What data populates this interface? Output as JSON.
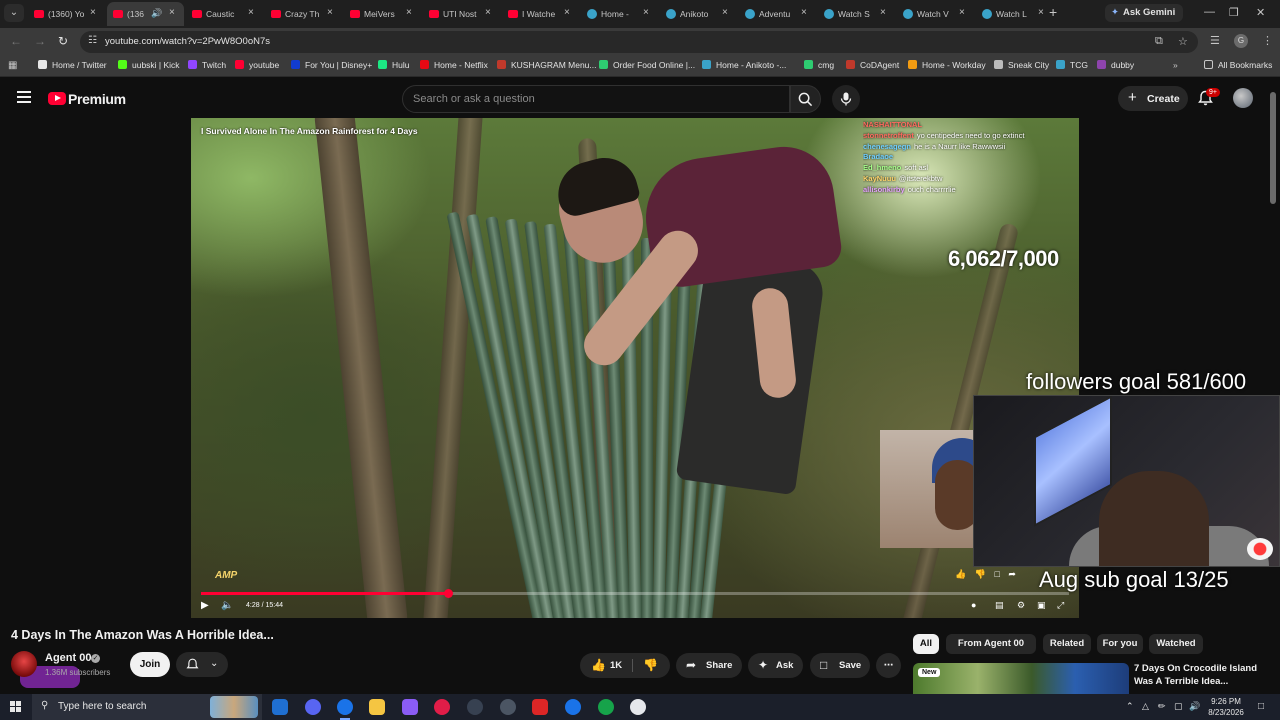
{
  "browser": {
    "tabs": [
      {
        "label": "(1360) Yo",
        "icon": "youtube-icon",
        "active": false
      },
      {
        "label": "(136",
        "icon": "youtube-icon",
        "active": true
      },
      {
        "label": "Caustic",
        "icon": "youtube-icon",
        "active": false
      },
      {
        "label": "Crazy Th",
        "icon": "youtube-icon",
        "active": false
      },
      {
        "label": "MeiVers",
        "icon": "youtube-icon",
        "active": false
      },
      {
        "label": "UTI Nost",
        "icon": "youtube-icon",
        "active": false
      },
      {
        "label": "I Watche",
        "icon": "youtube-icon",
        "active": false
      },
      {
        "label": "Home -",
        "icon": "globe-icon",
        "active": false
      },
      {
        "label": "Anikoto",
        "icon": "globe-icon",
        "active": false
      },
      {
        "label": "Adventu",
        "icon": "globe-icon",
        "active": false
      },
      {
        "label": "Watch S",
        "icon": "globe-icon",
        "active": false
      },
      {
        "label": "Watch V",
        "icon": "globe-icon",
        "active": false
      },
      {
        "label": "Watch L",
        "icon": "globe-icon",
        "active": false
      }
    ],
    "ask_gemini": "Ask Gemini",
    "url": "youtube.com/watch?v=2PwW8O0oN7s",
    "bookmarks": [
      {
        "label": "Home / Twitter",
        "color": "#e7e7e7"
      },
      {
        "label": "uubski | Kick",
        "color": "#53fc18"
      },
      {
        "label": "Twitch",
        "color": "#9146ff"
      },
      {
        "label": "youtube",
        "color": "#ff0033"
      },
      {
        "label": "For You | Disney+",
        "color": "#113ccf"
      },
      {
        "label": "Hulu",
        "color": "#1ce783"
      },
      {
        "label": "Home - Netflix",
        "color": "#e50914"
      },
      {
        "label": "KUSHAGRAM Menu...",
        "color": "#c0392b"
      },
      {
        "label": "Order Food Online |...",
        "color": "#2ecc71"
      },
      {
        "label": "Home - Anikoto -...",
        "color": "#3aa3c9"
      },
      {
        "label": "cmg",
        "color": "#2ecc71"
      },
      {
        "label": "CoDAgent",
        "color": "#c0392b"
      },
      {
        "label": "Home - Workday",
        "color": "#f39c12"
      },
      {
        "label": "Sneak City",
        "color": "#bbbbbb"
      },
      {
        "label": "TCG",
        "color": "#3aa3c9"
      },
      {
        "label": "dubby",
        "color": "#8e44ad"
      }
    ],
    "all_bookmarks": "All Bookmarks"
  },
  "youtube": {
    "brand": "Premium",
    "search_placeholder": "Search or ask a question",
    "create_label": "Create",
    "notif_count": "9+"
  },
  "video": {
    "overlay_title": "I Survived Alone In The Amazon Rainforest for 4 Days",
    "chat": [
      {
        "user": "NASHAITTONAL",
        "msg": ""
      },
      {
        "user": "stonnetroffent",
        "msg": "yo centipedes need to go extinct"
      },
      {
        "user": "chenesagegn",
        "msg": "he is a Naurr like Rawwwsii"
      },
      {
        "user": "Bradaoe",
        "msg": ""
      },
      {
        "user": "Ed_hmeno",
        "msg": "soft asl"
      },
      {
        "user": "KayNuuu",
        "msg": "@itsterekbtw"
      },
      {
        "user": "allisonkirby",
        "msg": "ouch charrrrlie"
      }
    ],
    "counter": "6,062/7,000",
    "watermark": "AMP",
    "time": "4:28 / 15:44",
    "progress": 0.285
  },
  "stream": {
    "followers_goal": "followers goal 581/600",
    "sub_goal": "Aug sub goal 13/25"
  },
  "meta": {
    "title": "4 Days In The Amazon Was A Horrible Idea...",
    "channel": "Agent 00",
    "subscribers": "1.36M subscribers",
    "join": "Join",
    "likes": "1K",
    "share": "Share",
    "ask": "Ask",
    "save": "Save"
  },
  "chips": [
    "All",
    "From Agent 00",
    "Related",
    "For you",
    "Watched"
  ],
  "recommendation": {
    "badge": "New",
    "title": "7 Days On Crocodile Island Was A Terrible Idea..."
  },
  "taskbar": {
    "search_placeholder": "Type here to search",
    "time": "9:26 PM",
    "date": "8/23/2026"
  }
}
